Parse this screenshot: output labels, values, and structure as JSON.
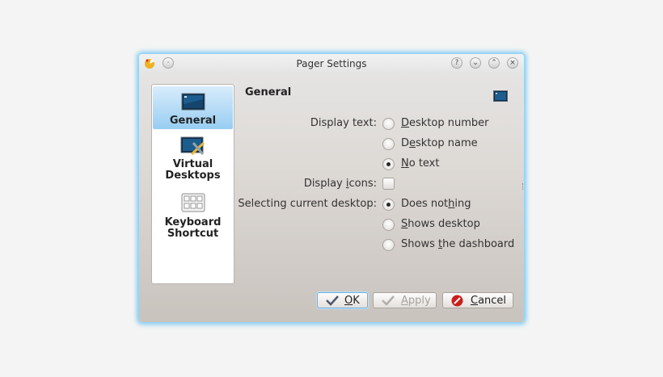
{
  "window": {
    "title": "Pager Settings",
    "title_buttons": [
      "?",
      "⌄",
      "⌃",
      "×"
    ]
  },
  "sidebar": {
    "items": [
      {
        "label": "General",
        "icon": "desktop-icon",
        "selected": true
      },
      {
        "label_line1": "Virtual",
        "label_line2": "Desktops",
        "icon": "virtual-desktops-icon",
        "selected": false
      },
      {
        "label_line1": "Keyboard",
        "label_line2": "Shortcut",
        "icon": "keyboard-icon",
        "selected": false
      }
    ]
  },
  "page": {
    "heading": "General",
    "display_text": {
      "label": "Display text:",
      "options": [
        {
          "label": "Desktop number",
          "mnemonic": "D",
          "selected": false
        },
        {
          "label": "Desktop name",
          "mnemonic": "e",
          "selected": false
        },
        {
          "label": "No text",
          "mnemonic": "N",
          "selected": true
        }
      ]
    },
    "display_icons": {
      "label_pre": "Display ",
      "label_u": "i",
      "label_post": "cons:",
      "checked": false
    },
    "selecting": {
      "label": "Selecting current desktop:",
      "options": [
        {
          "pre": "Does not",
          "u": "h",
          "post": "ing",
          "selected": true
        },
        {
          "pre": "",
          "u": "S",
          "post": "hows desktop",
          "selected": false
        },
        {
          "pre": "Shows ",
          "u": "t",
          "post": "he dashboard",
          "selected": false
        }
      ]
    }
  },
  "buttons": {
    "ok": {
      "u": "O",
      "rest": "K"
    },
    "apply": {
      "u": "A",
      "rest": "pply"
    },
    "cancel": {
      "u": "C",
      "rest": "ancel"
    }
  },
  "colors": {
    "accent": "#6ab1e3",
    "selection": "#97cdf2"
  }
}
